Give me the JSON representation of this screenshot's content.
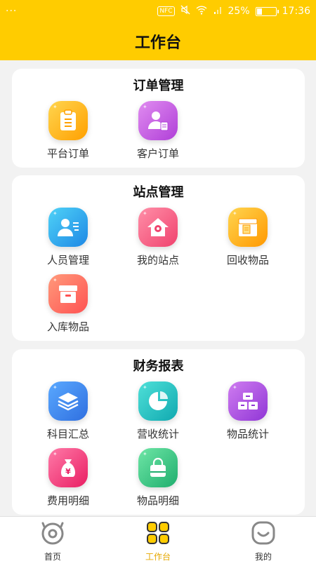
{
  "status": {
    "menu": "···",
    "nfc": "NFC",
    "battery": "25%",
    "battery_level": 0.25,
    "time": "17:36"
  },
  "header": {
    "title": "工作台"
  },
  "sections": {
    "orders": {
      "title": "订单管理",
      "items": [
        {
          "label": "平台订单",
          "icon": "clipboard-icon",
          "color": "#ffb300"
        },
        {
          "label": "客户订单",
          "icon": "customer-doc-icon",
          "color": "#c86be0"
        }
      ]
    },
    "sites": {
      "title": "站点管理",
      "items": [
        {
          "label": "人员管理",
          "icon": "person-card-icon",
          "color": "#29b6f6"
        },
        {
          "label": "我的站点",
          "icon": "home-location-icon",
          "color": "#ff6f8a"
        },
        {
          "label": "回收物品",
          "icon": "recycle-box-icon",
          "color": "#ffb300"
        },
        {
          "label": "入库物品",
          "icon": "storage-box-icon",
          "color": "#ff7a59"
        }
      ]
    },
    "finance": {
      "title": "财务报表",
      "items": [
        {
          "label": "科目汇总",
          "icon": "layers-icon",
          "color": "#3d8bf2"
        },
        {
          "label": "营收统计",
          "icon": "pie-chart-icon",
          "color": "#26c6c6"
        },
        {
          "label": "物品统计",
          "icon": "boxes-icon",
          "color": "#b35be0"
        },
        {
          "label": "费用明细",
          "icon": "money-bag-icon",
          "color": "#ff4f88"
        },
        {
          "label": "物品明细",
          "icon": "shopping-bag-icon",
          "color": "#37c88a"
        }
      ]
    }
  },
  "tabs": [
    {
      "label": "首页",
      "icon": "home-face-icon",
      "active": false
    },
    {
      "label": "工作台",
      "icon": "grid-icon",
      "active": true
    },
    {
      "label": "我的",
      "icon": "smile-icon",
      "active": false
    }
  ],
  "colors": {
    "accent": "#ffcc00",
    "active_tab": "#e6a800"
  }
}
